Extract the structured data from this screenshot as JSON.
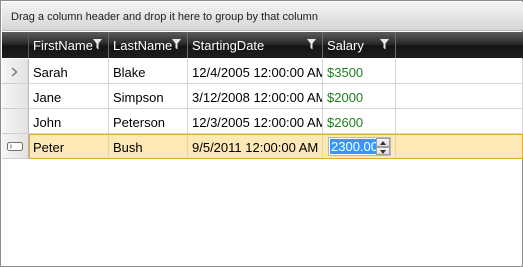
{
  "group_panel": {
    "text": "Drag a column header and drop it here to group by that column"
  },
  "columns": [
    {
      "label": "FirstName"
    },
    {
      "label": "LastName"
    },
    {
      "label": "StartingDate"
    },
    {
      "label": "Salary"
    }
  ],
  "rows": [
    {
      "first": "Sarah",
      "last": "Blake",
      "date": "12/4/2005 12:00:00 AM",
      "salary": "$3500"
    },
    {
      "first": "Jane",
      "last": "Simpson",
      "date": "3/12/2008 12:00:00 AM",
      "salary": "$2000"
    },
    {
      "first": "John",
      "last": "Peterson",
      "date": "12/3/2005 12:00:00 AM",
      "salary": "$2600"
    },
    {
      "first": "Peter",
      "last": "Bush",
      "date": "9/5/2011 12:00:00 AM",
      "salary_edit": "2300.00"
    }
  ],
  "colors": {
    "salary_text": "#1f7f1f",
    "edit_row_bg": "#fde9b5",
    "header_bg": "#1e1e1e",
    "selection": "#3399ff"
  },
  "icons": {
    "current_row": "chevron-right-icon",
    "edit_row": "edit-row-icon",
    "filter": "filter-funnel-icon"
  }
}
